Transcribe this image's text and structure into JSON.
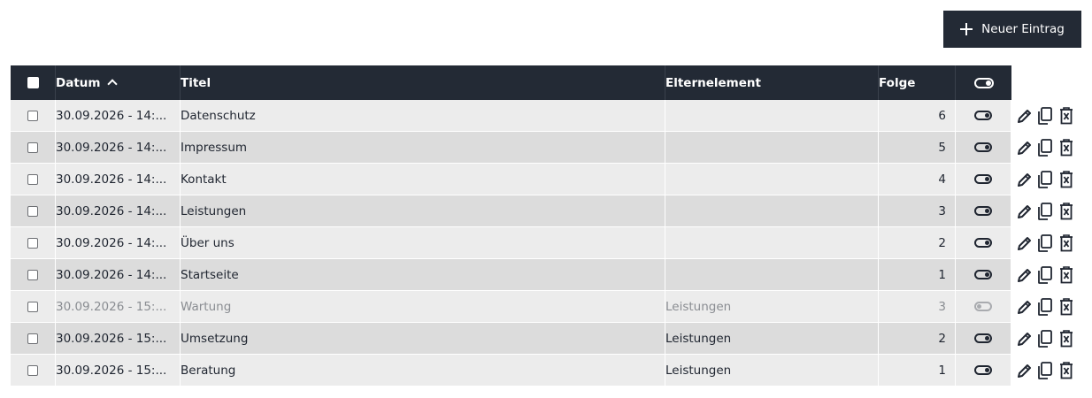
{
  "toolbar": {
    "new_entry_label": "Neuer Eintrag"
  },
  "table": {
    "columns": {
      "date": "Datum",
      "title": "Titel",
      "parent": "Elternelement",
      "order": "Folge"
    },
    "rows": [
      {
        "date": "30.09.2026 - 14:...",
        "title": "Datenschutz",
        "parent": "",
        "order": "6",
        "active": true
      },
      {
        "date": "30.09.2026 - 14:...",
        "title": "Impressum",
        "parent": "",
        "order": "5",
        "active": true
      },
      {
        "date": "30.09.2026 - 14:...",
        "title": "Kontakt",
        "parent": "",
        "order": "4",
        "active": true
      },
      {
        "date": "30.09.2026 - 14:...",
        "title": "Leistungen",
        "parent": "",
        "order": "3",
        "active": true
      },
      {
        "date": "30.09.2026 - 14:...",
        "title": "Über uns",
        "parent": "",
        "order": "2",
        "active": true
      },
      {
        "date": "30.09.2026 - 14:...",
        "title": "Startseite",
        "parent": "",
        "order": "1",
        "active": true
      },
      {
        "date": "30.09.2026 - 15:...",
        "title": "Wartung",
        "parent": "Leistungen",
        "order": "3",
        "active": false
      },
      {
        "date": "30.09.2026 - 15:...",
        "title": "Umsetzung",
        "parent": "Leistungen",
        "order": "2",
        "active": true
      },
      {
        "date": "30.09.2026 - 15:...",
        "title": "Beratung",
        "parent": "Leistungen",
        "order": "1",
        "active": true
      }
    ]
  },
  "icons": {
    "toolbar": "plus-icon",
    "sort": "chevron-up-icon",
    "status": "toggle-icon",
    "edit": "pencil-icon",
    "copy": "copy-icon",
    "delete": "trash-icon"
  },
  "colors": {
    "header_bg": "#232a35",
    "row_odd": "#ececec",
    "row_even": "#dcdcdc",
    "inactive_text": "#8a8d92"
  }
}
